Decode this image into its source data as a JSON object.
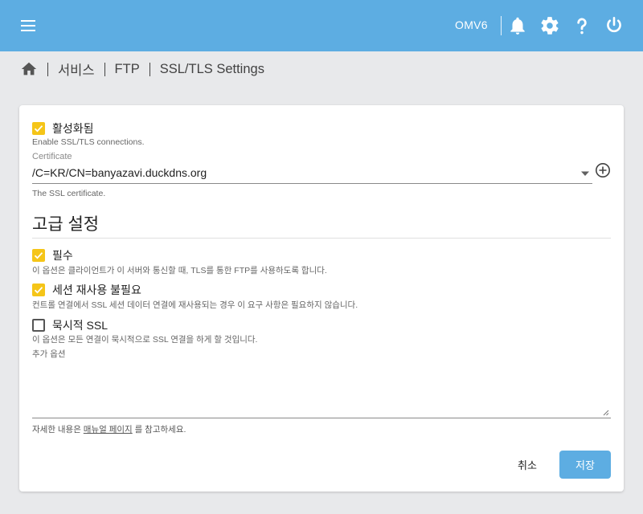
{
  "colors": {
    "topbar": "#5dade2",
    "accent_checkbox": "#f5c518",
    "primary_button": "#5dade2"
  },
  "header": {
    "hostname": "OMV6",
    "icons": [
      "menu-icon",
      "bell-icon",
      "gear-icon",
      "help-icon",
      "power-icon"
    ]
  },
  "breadcrumb": {
    "home_icon": "home-icon",
    "items": [
      "서비스",
      "FTP",
      "SSL/TLS Settings"
    ]
  },
  "form": {
    "enabled": {
      "label": "활성화됨",
      "checked": true,
      "hint": "Enable SSL/TLS connections."
    },
    "certificate": {
      "label": "Certificate",
      "value": "/C=KR/CN=banyazavi.duckdns.org",
      "hint": "The SSL certificate."
    },
    "advanced_title": "고급 설정",
    "required": {
      "label": "필수",
      "checked": true,
      "hint": "이 옵션은 클라이언트가 이 서버와 통신할 때, TLS를 통한 FTP를 사용하도록 합니다."
    },
    "no_session_reuse": {
      "label": "세션 재사용 불필요",
      "checked": true,
      "hint": "컨트롤 연결에서 SSL 세션 데이터 연결에 재사용되는 경우 이 요구 사항은 필요하지 않습니다."
    },
    "implicit_ssl": {
      "label": "묵시적 SSL",
      "checked": false,
      "hint": "이 옵션은 모든 연결이 묵시적으로 SSL 연결을 하게 할 것입니다."
    },
    "extra_options": {
      "label": "추가 옵션",
      "value": ""
    },
    "footnote": {
      "before": "자세한 내용은 ",
      "link": "매뉴얼 페이지",
      "after": " 를 참고하세요."
    }
  },
  "actions": {
    "cancel": "취소",
    "save": "저장"
  }
}
